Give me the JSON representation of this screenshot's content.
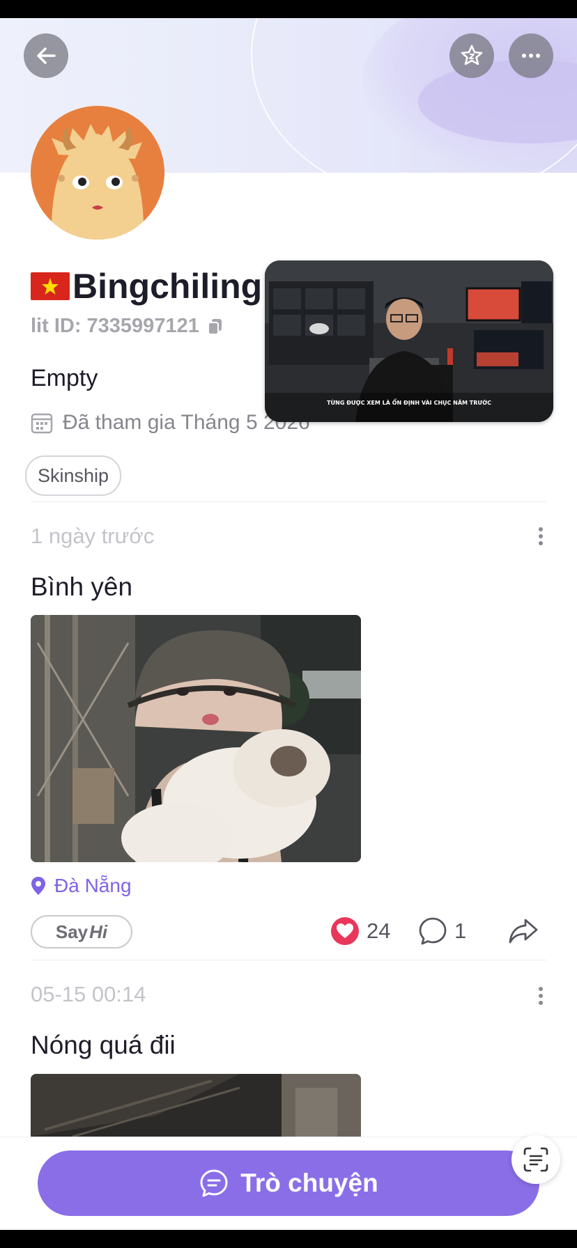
{
  "header": {
    "back_icon": "arrow-left-icon",
    "favorite_icon": "star-badge-icon",
    "more_icon": "more-dots-icon"
  },
  "profile": {
    "flag_emoji": "🇻🇳",
    "name": "Bingchiling",
    "lit_id": "lit ID: 7335997121",
    "bio": "Empty",
    "joined": "Đã tham gia Tháng 5 2026",
    "tags": [
      "Skinship"
    ]
  },
  "video_overlay": {
    "subtitle": "TỪNG ĐƯỢC XEM LÀ ỔN ĐỊNH VÀI CHỤC NĂM TRƯỚC"
  },
  "posts": [
    {
      "time": "1 ngày trước",
      "title": "Bình yên",
      "location": "Đà Nẵng",
      "sayhi_say": "Say",
      "sayhi_hi": "Hi",
      "likes": "24",
      "comments": "1"
    },
    {
      "time": "05-15 00:14",
      "title": "Nóng quá đii"
    }
  ],
  "bottom": {
    "chat_label": "Trò chuyện"
  },
  "colors": {
    "accent": "#8a6ee8",
    "like": "#e8375a",
    "location": "#7f63e6"
  }
}
